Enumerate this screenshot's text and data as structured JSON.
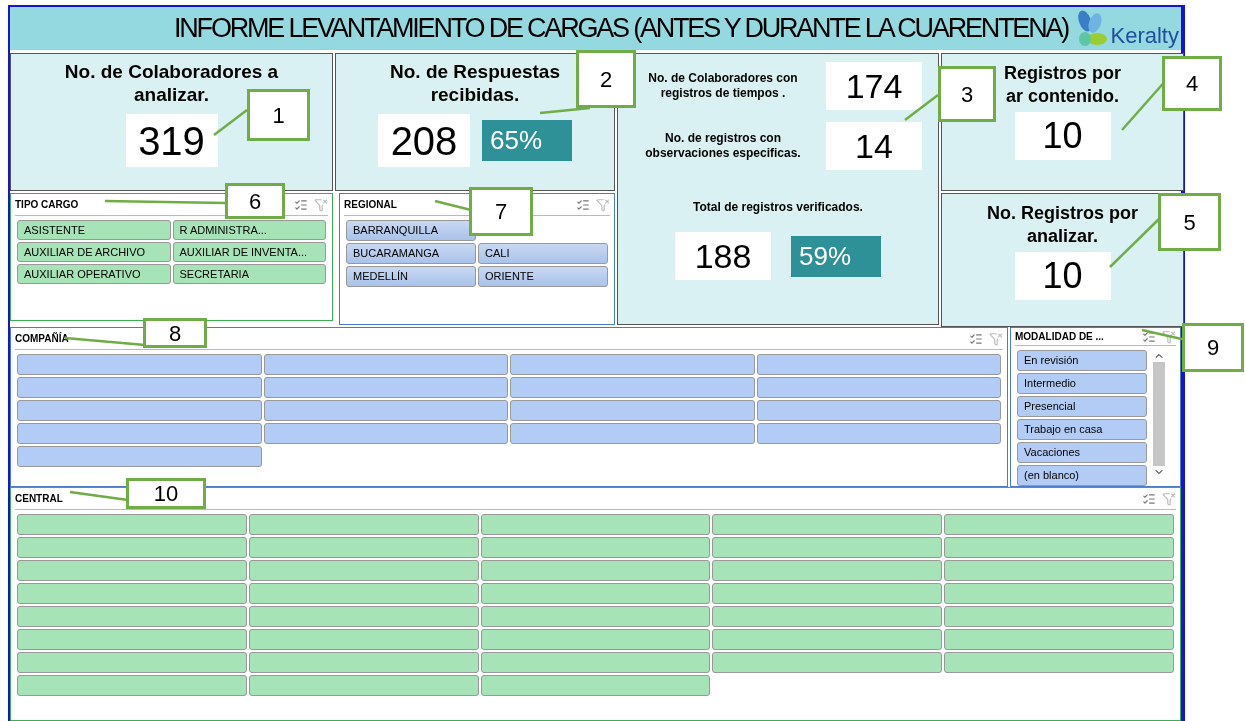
{
  "header": {
    "title": "INFORME LEVANTAMIENTO DE CARGAS (ANTES Y DURANTE LA CUARENTENA)",
    "logo_text": "Keralty"
  },
  "kpis": [
    {
      "kind": "count",
      "title": "No. de Colaboradores a analizar.",
      "value": "319"
    },
    {
      "kind": "ratio",
      "title": "No. de Respuestas recibidas.",
      "value": "208",
      "percent": "65%"
    }
  ],
  "metrics_panel": [
    {
      "kind": "side",
      "label": "No. de Colaboradores con registros de tiempos .",
      "value": "174"
    },
    {
      "kind": "side",
      "label": "No. de registros con observaciones especificas.",
      "value": "14"
    },
    {
      "kind": "stacked",
      "label": "Total de registros verificados.",
      "value": "188",
      "percent": "59%"
    }
  ],
  "right_kpis": [
    {
      "title_lines": [
        "Registros por",
        "ar contenido."
      ],
      "value": "10"
    },
    {
      "title_lines": [
        "No. Registros por",
        "analizar."
      ],
      "value": "10"
    }
  ],
  "tipo_cargo": {
    "title": "TIPO CARGO",
    "items": [
      {
        "label": "ASISTENTE",
        "selected": true
      },
      {
        "label": "R ADMINISTRA...",
        "selected": true
      },
      {
        "label": "AUXILIAR DE ARCHIVO",
        "selected": true
      },
      {
        "label": "AUXILIAR DE INVENTA...",
        "selected": true
      },
      {
        "label": "AUXILIAR OPERATIVO",
        "selected": true
      },
      {
        "label": "SECRETARIA",
        "selected": true
      }
    ]
  },
  "regional": {
    "title": "REGIONAL",
    "items": [
      {
        "label": "BARRANQUILLA",
        "selected": true
      },
      {
        "kind": "covered"
      },
      {
        "label": "BUCARAMANGA",
        "selected": true
      },
      {
        "label": "CALI",
        "selected": true
      },
      {
        "label": "MEDELLÍN",
        "selected": true
      },
      {
        "label": "ORIENTE",
        "selected": true
      }
    ]
  },
  "compania": {
    "title": "COMPAÑÍA",
    "items": [
      {
        "selected": true
      },
      {
        "selected": true
      },
      {
        "selected": true
      },
      {
        "selected": true
      },
      {
        "selected": true
      },
      {
        "selected": true
      },
      {
        "selected": true
      },
      {
        "selected": true
      },
      {
        "selected": true
      },
      {
        "selected": true
      },
      {
        "selected": true
      },
      {
        "selected": true
      },
      {
        "selected": true
      },
      {
        "selected": true
      },
      {
        "selected": true
      },
      {
        "selected": true
      },
      {
        "selected": true
      }
    ]
  },
  "modalidad": {
    "title": "MODALIDAD DE ...",
    "items": [
      {
        "label": "En revisión",
        "selected": true
      },
      {
        "label": "Intermedio",
        "selected": true
      },
      {
        "label": "Presencial",
        "selected": true
      },
      {
        "label": "Trabajo en casa",
        "selected": true
      },
      {
        "label": "Vacaciones",
        "selected": true
      },
      {
        "label": "(en blanco)",
        "selected": true
      }
    ]
  },
  "central": {
    "title": "CENTRAL",
    "items": [
      {
        "selected": true
      },
      {
        "selected": true
      },
      {
        "selected": true
      },
      {
        "selected": true
      },
      {
        "selected": true
      },
      {
        "selected": true
      },
      {
        "selected": true
      },
      {
        "selected": true
      },
      {
        "selected": true
      },
      {
        "selected": true
      },
      {
        "selected": true
      },
      {
        "selected": true
      },
      {
        "selected": true
      },
      {
        "selected": true
      },
      {
        "selected": true
      },
      {
        "selected": true
      },
      {
        "selected": true
      },
      {
        "selected": true
      },
      {
        "selected": true
      },
      {
        "selected": true
      },
      {
        "selected": true
      },
      {
        "selected": true
      },
      {
        "selected": true
      },
      {
        "selected": true
      },
      {
        "selected": true
      },
      {
        "selected": true
      },
      {
        "selected": true
      },
      {
        "selected": true
      },
      {
        "selected": true
      },
      {
        "selected": true
      },
      {
        "selected": true
      },
      {
        "selected": true
      },
      {
        "selected": true
      },
      {
        "selected": true
      },
      {
        "selected": true
      },
      {
        "selected": true
      },
      {
        "selected": true
      },
      {
        "selected": true
      }
    ]
  },
  "callouts": [
    {
      "label": "1"
    },
    {
      "label": "2"
    },
    {
      "label": "3"
    },
    {
      "label": "4"
    },
    {
      "label": "5"
    },
    {
      "label": "6"
    },
    {
      "label": "7"
    },
    {
      "label": "8"
    },
    {
      "label": "9"
    },
    {
      "label": "10"
    }
  ]
}
